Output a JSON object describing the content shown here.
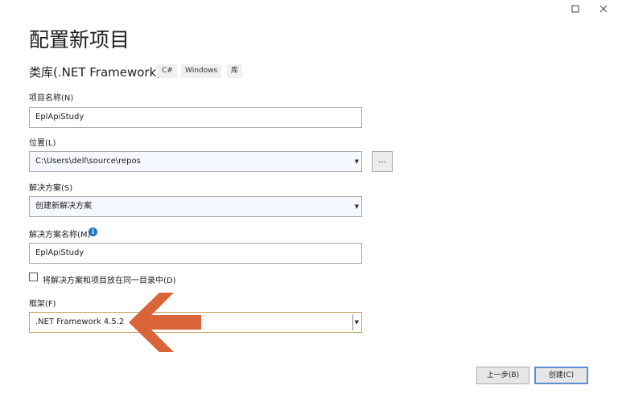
{
  "window": {
    "controls": {
      "maximize_icon": "maximize-icon",
      "close_icon": "close-icon"
    }
  },
  "header": {
    "title": "配置新项目",
    "template_name": "类库(.NET Framework)",
    "tags": [
      "C#",
      "Windows",
      "库"
    ]
  },
  "form": {
    "project_name": {
      "label": "项目名称(N)",
      "value": "EplApiStudy"
    },
    "location": {
      "label": "位置(L)",
      "value": "C:\\Users\\dell\\source\\repos",
      "browse_label": "..."
    },
    "solution": {
      "label": "解决方案(S)",
      "value": "创建新解决方案"
    },
    "solution_name": {
      "label": "解决方案名称(M)",
      "value": "EplApiStudy",
      "info_icon": "info-icon"
    },
    "same_directory": {
      "label": "将解决方案和项目放在同一目录中(D)",
      "checked": false
    },
    "framework": {
      "label": "框架(F)",
      "value": ".NET Framework 4.5.2"
    }
  },
  "footer": {
    "back_label": "上一步(B)",
    "create_label": "创建(C)"
  },
  "annotation": {
    "arrow_color": "#d9643a"
  },
  "colors": {
    "accent": "#5b8fd6",
    "highlight_border": "#c8a564",
    "info": "#1a74c9"
  }
}
